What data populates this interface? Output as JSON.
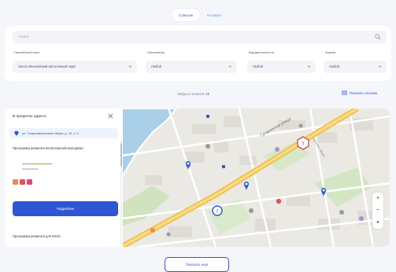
{
  "view_toggle": {
    "active": "Списком",
    "inactive": "На карте"
  },
  "search": {
    "placeholder": "Поиск"
  },
  "filters": [
    {
      "label": "Населённый пункт",
      "value": "Ханты-Мансийский автономный округ"
    },
    {
      "label": "Организатор",
      "value": "Любой"
    },
    {
      "label": "Вид деятельности",
      "value": "Любой"
    },
    {
      "label": "Формат",
      "value": "Любой"
    }
  ],
  "results": {
    "text": "Найдено записей:",
    "count": "46"
  },
  "show_list": "Показать списком",
  "panel": {
    "title": "В пределах адреса",
    "address": "ул. Гагарина/проспект Мира, д. 20, к. 3",
    "program1": "Программа развития волонтёрской молодёжи",
    "program1_sub": "информация",
    "details_button": "Подробнее",
    "program2": "Программа развития для ЮНИ"
  },
  "map": {
    "street_1": "Гагаринская улица",
    "street_2": "проспект Мира",
    "cluster_count": "2",
    "cluster_count_2": "3"
  },
  "zoom": {
    "in": "+",
    "out": "−",
    "locate": "➤"
  },
  "more_button": "Показать ещё",
  "colors": {
    "accent": "#2f55d4",
    "pin_blue": "#2f55d4",
    "badge_orange": "#f08a4b",
    "badge_red": "#e8505b",
    "badge_pink": "#e0467c"
  }
}
